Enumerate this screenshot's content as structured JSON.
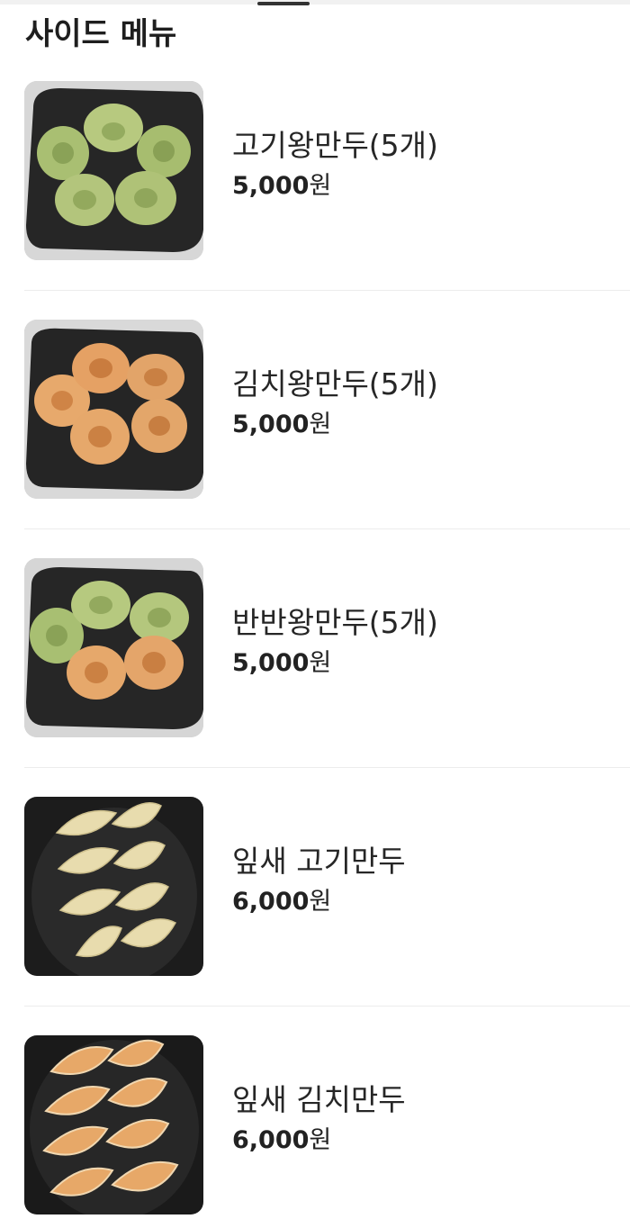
{
  "section": {
    "title": "사이드 메뉴"
  },
  "menu": {
    "items": [
      {
        "name": "고기왕만두(5개)",
        "price": "5,000",
        "unit": "원",
        "photo": "round-dumplings-green"
      },
      {
        "name": "김치왕만두(5개)",
        "price": "5,000",
        "unit": "원",
        "photo": "round-dumplings-orange"
      },
      {
        "name": "반반왕만두(5개)",
        "price": "5,000",
        "unit": "원",
        "photo": "round-dumplings-mixed"
      },
      {
        "name": "잎새 고기만두",
        "price": "6,000",
        "unit": "원",
        "photo": "leaf-dumplings-plain"
      },
      {
        "name": "잎새 김치만두",
        "price": "6,000",
        "unit": "원",
        "photo": "leaf-dumplings-orange"
      }
    ]
  },
  "colors": {
    "plate": "#262626",
    "green_dumpling": "#a9bf72",
    "orange_dumpling": "#e2a56a",
    "plain_dumpling": "#e8dcae",
    "divider": "#ececec"
  }
}
